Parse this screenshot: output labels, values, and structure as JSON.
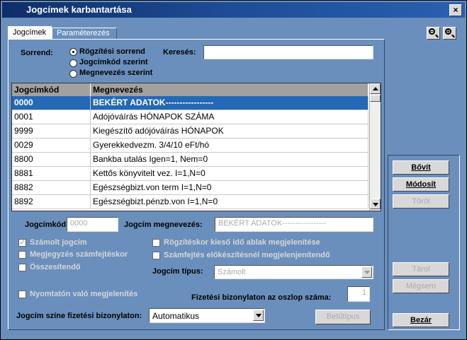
{
  "window": {
    "title": "Jogcímek karbantartása",
    "close_glyph": "×"
  },
  "tabs": [
    {
      "label": "Jogcímek",
      "active": true
    },
    {
      "label": "Paraméterezés",
      "active": false
    }
  ],
  "sort": {
    "label": "Sorrend:",
    "options": [
      "Rögzítési sorrend",
      "Jogcímkód szerint",
      "Megnevezés szerint"
    ],
    "selected": "Rögzítési sorrend"
  },
  "search": {
    "label": "Keresés:",
    "value": ""
  },
  "grid": {
    "columns": [
      "Jogcímkód",
      "Megnevezés"
    ],
    "rows": [
      {
        "code": "0000",
        "name": "BEKÉRT ADATOK-----------------",
        "selected": true
      },
      {
        "code": "0001",
        "name": "Adójóváírás   HÓNAPOK SZÁMA"
      },
      {
        "code": "9999",
        "name": "Kiegészítő adójóváírás HÓNAPOK"
      },
      {
        "code": "0029",
        "name": "Gyerekkedvezm. 3/4/10 eFt/hó"
      },
      {
        "code": "8800",
        "name": "Bankba utalás Igen=1, Nem=0"
      },
      {
        "code": "8881",
        "name": "Kettős könyvitelt vez. I=1,N=0"
      },
      {
        "code": "8882",
        "name": "Egészségbizt.von term  I=1,N=0"
      },
      {
        "code": "8892",
        "name": "Egészségbizt.pénzb.von I=1,N=0"
      }
    ]
  },
  "form": {
    "code_label": "Jogcímkód:",
    "code_value": "0000",
    "name_label": "Jogcím megnevezés:",
    "name_value": "BEKÉRT ADATOK-----------------",
    "chk_szamolt": "Számolt jogcím",
    "chk_megjegyzes": "Megjegyzés számfejtéskor",
    "chk_osszesitendo": "Összesítendő",
    "chk_rogzites": "Rögzítéskor kieső idő ablak megjelenítése",
    "chk_szamfejtes": "Számfejtés előkészítésnél megjelenjenítendő",
    "tipus_label": "Jogcím típus:",
    "tipus_value": "Számolt",
    "chk_nyomtatvany": "Nyomtatón való megjelenítés",
    "oszlop_label": "Fizetési bizonylaton az oszlop száma:",
    "oszlop_value": "1",
    "szin_label": "Jogcím színe fizetési bizonylaton:",
    "szin_value": "Automatikus",
    "betutipus": "Betűtípus"
  },
  "buttons": {
    "bovit": "Bővít",
    "modosit": "Módosít",
    "torol": "Töröl",
    "tarol": "Tárol",
    "megsem": "Mégsem",
    "bezar": "Bezár"
  },
  "zoom": {
    "out": "−",
    "in": "+"
  }
}
